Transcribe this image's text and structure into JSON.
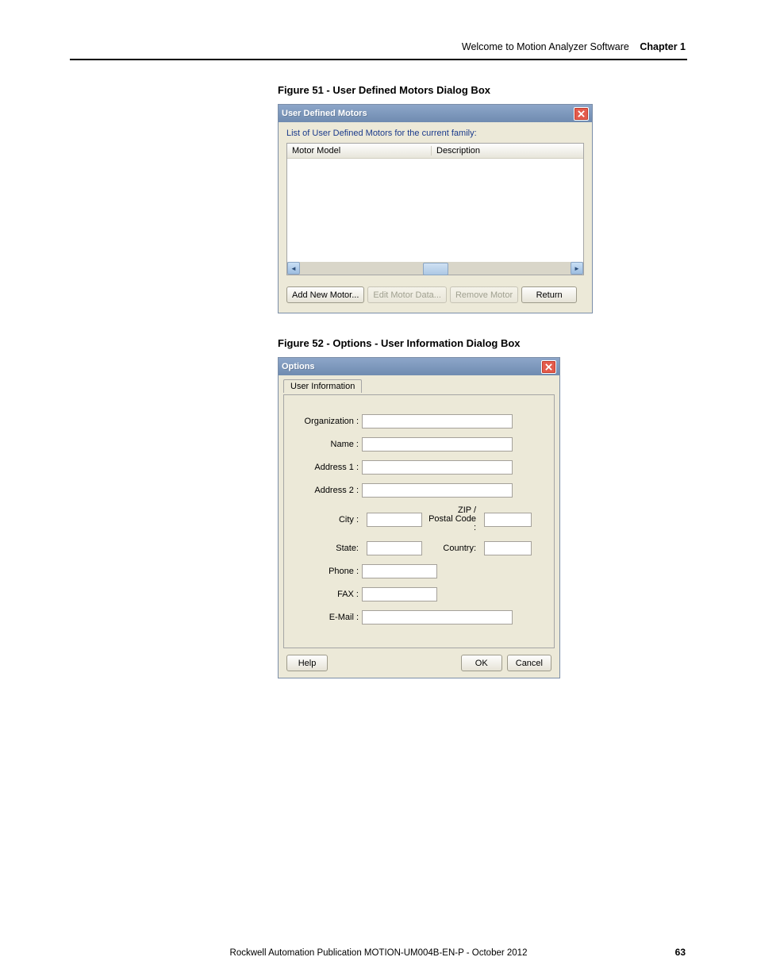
{
  "header": {
    "section": "Welcome to Motion Analyzer Software",
    "chapter": "Chapter 1"
  },
  "figure51": {
    "caption": "Figure 51 - User Defined Motors Dialog Box",
    "title": "User Defined Motors",
    "subtitle": "List of User Defined Motors for the current family:",
    "col_motor": "Motor Model",
    "col_desc": "Description",
    "btn_add": "Add New Motor...",
    "btn_edit": "Edit Motor Data...",
    "btn_remove": "Remove Motor",
    "btn_return": "Return"
  },
  "figure52": {
    "caption": "Figure 52 - Options - User Information Dialog Box",
    "title": "Options",
    "tab": "User Information",
    "labels": {
      "org": "Organization :",
      "name": "Name :",
      "addr1": "Address 1 :",
      "addr2": "Address 2 :",
      "city": "City :",
      "zip": "ZIP /\nPostal Code :",
      "state": "State:",
      "country": "Country:",
      "phone": "Phone :",
      "fax": "FAX :",
      "email": "E-Mail :"
    },
    "btn_help": "Help",
    "btn_ok": "OK",
    "btn_cancel": "Cancel"
  },
  "footer": {
    "text": "Rockwell Automation Publication MOTION-UM004B-EN-P - October 2012",
    "page": "63"
  }
}
